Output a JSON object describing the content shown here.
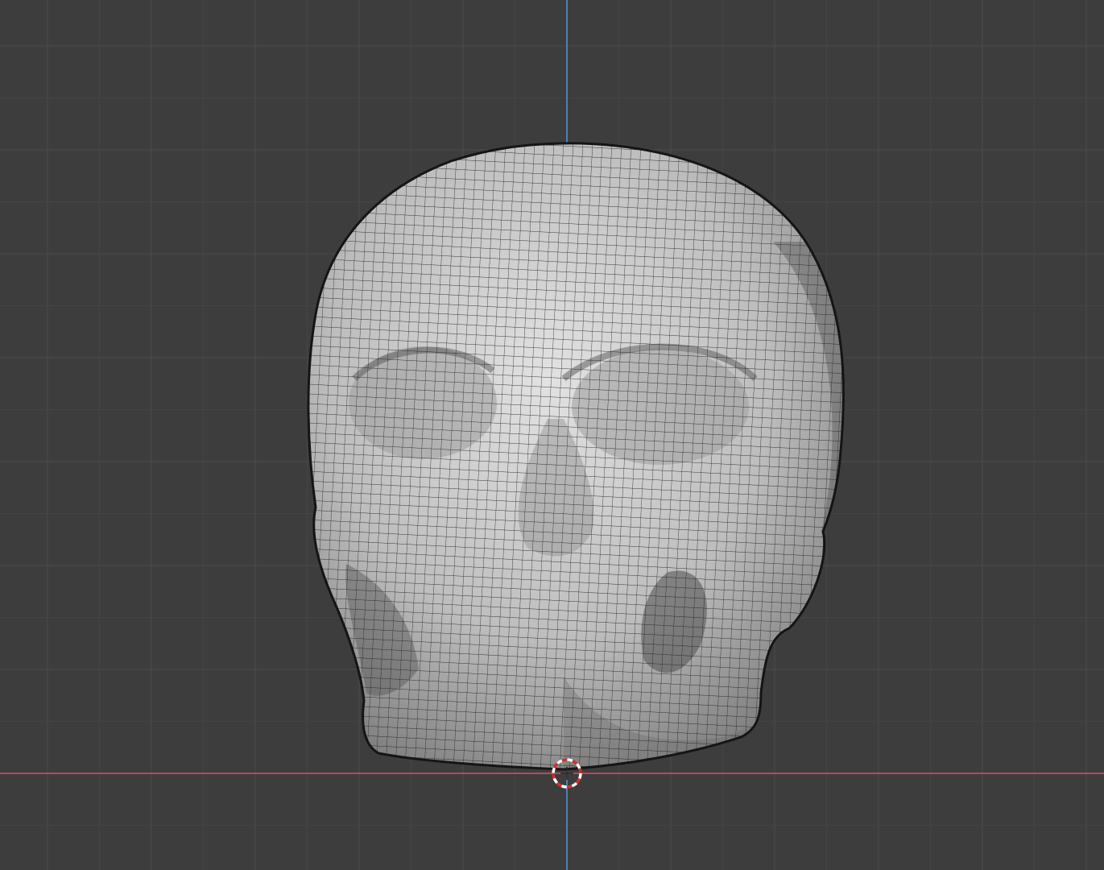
{
  "viewport": {
    "background_color": "#3d3d3d",
    "grid_minor_color": "#444444",
    "grid_major_color": "#4c4c4c",
    "axis_x_color": "#b54b5a",
    "axis_z_color": "#4d7fb3",
    "mesh_fill_light": "#d8d8d8",
    "mesh_fill_dark": "#7a7a7a",
    "wire_color": "#1e1e1e",
    "cursor_color_a": "#ffffff",
    "cursor_color_b": "#d03030"
  },
  "scene": {
    "object": "skull-mesh",
    "display_mode": "solid-with-wireframe",
    "view": "front-orthographic"
  },
  "icons": {
    "cursor": "3d-cursor-icon"
  }
}
